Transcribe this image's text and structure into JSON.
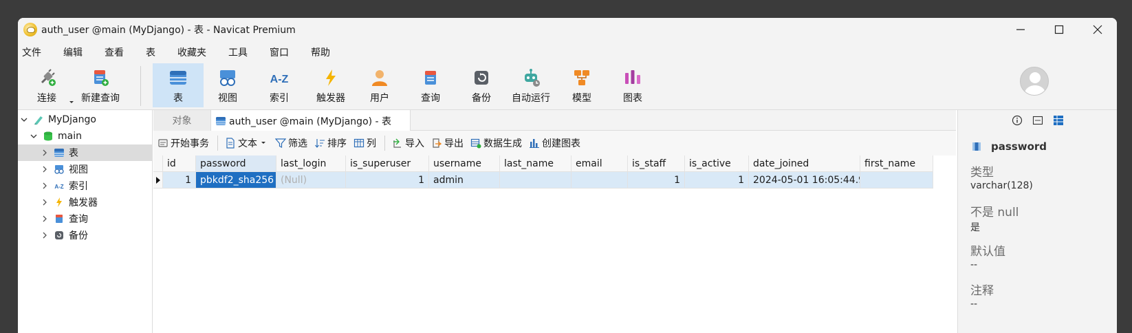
{
  "window": {
    "title": "auth_user @main (MyDjango) - 表 - Navicat Premium"
  },
  "menu": [
    "文件",
    "编辑",
    "查看",
    "表",
    "收藏夹",
    "工具",
    "窗口",
    "帮助"
  ],
  "toolbar": {
    "connect": "连接",
    "new_query": "新建查询",
    "table": "表",
    "view": "视图",
    "index": "索引",
    "trigger": "触发器",
    "user": "用户",
    "query": "查询",
    "backup": "备份",
    "automation": "自动运行",
    "model": "模型",
    "chart": "图表",
    "index_glyph": "A-Z"
  },
  "tree": {
    "connection": "MyDjango",
    "database": "main",
    "items": [
      "表",
      "视图",
      "索引",
      "触发器",
      "查询",
      "备份"
    ],
    "index_glyph": "A-Z"
  },
  "tabs": {
    "objects": "对象",
    "active": "auth_user @main (MyDjango) - 表"
  },
  "subbar": {
    "begin_transaction": "开始事务",
    "text": "文本",
    "filter": "筛选",
    "sort": "排序",
    "columns": "列",
    "import": "导入",
    "export": "导出",
    "data_generation": "数据生成",
    "create_chart": "创建图表"
  },
  "grid": {
    "columns": [
      "id",
      "password",
      "last_login",
      "is_superuser",
      "username",
      "last_name",
      "email",
      "is_staff",
      "is_active",
      "date_joined",
      "first_name"
    ],
    "row": [
      "1",
      "pbkdf2_sha256",
      "(Null)",
      "1",
      "admin",
      "",
      "",
      "1",
      "1",
      "2024-05-01 16:05:44.9",
      ""
    ]
  },
  "rpanel": {
    "field_name": "password",
    "type_label": "类型",
    "type_value": "varchar(128)",
    "notnull_label": "不是 null",
    "notnull_value": "是",
    "default_label": "默认值",
    "default_value": "--",
    "comment_label": "注释",
    "comment_value": "--"
  },
  "colors": {
    "accent": "#1f6fc2",
    "selected_row": "#d9e9f7",
    "toolbar_active": "#cfe4f7"
  }
}
